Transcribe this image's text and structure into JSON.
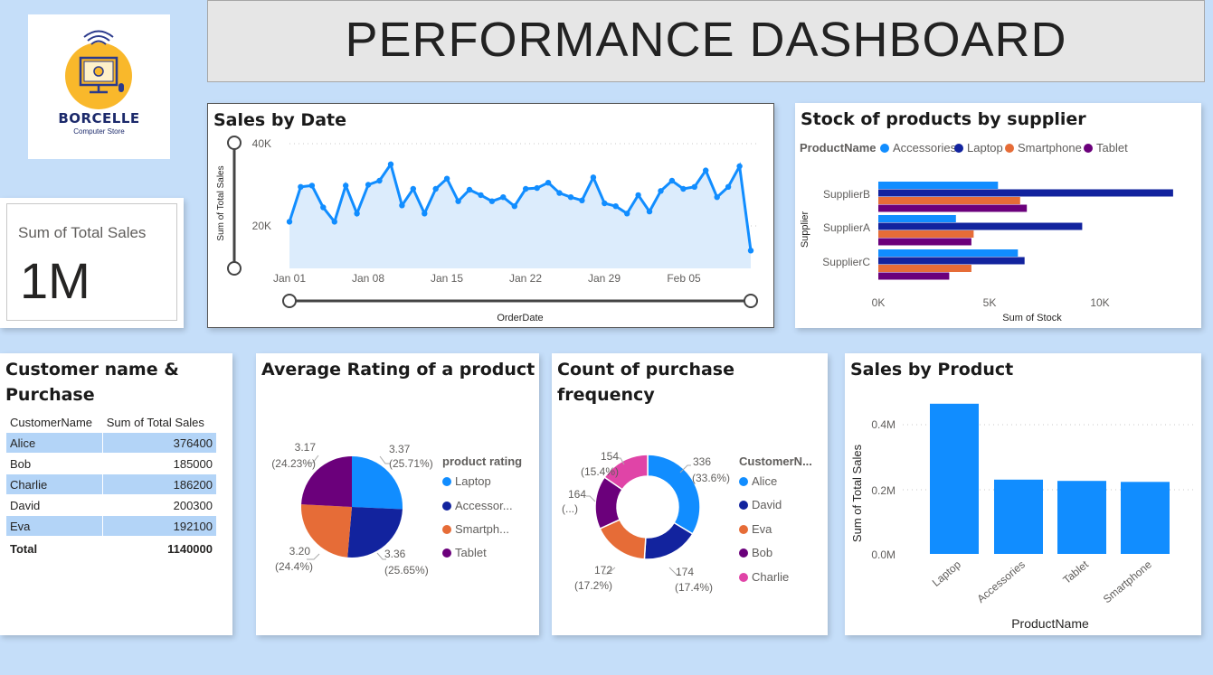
{
  "logo": {
    "brand": "BORCELLE",
    "tagline": "Computer Store"
  },
  "header": {
    "title": "PERFORMANCE DASHBOARD"
  },
  "kpi": {
    "label": "Sum of Total Sales",
    "value": "1M"
  },
  "colors": {
    "blue": "#118dff",
    "navy": "#12239e",
    "orange": "#e66c37",
    "purple": "#6b007b",
    "pink": "#e044a7",
    "area": "#dcecfc"
  },
  "sales_by_date": {
    "title": "Sales by Date",
    "ylabel": "Sum of Total Sales",
    "xlabel": "OrderDate",
    "yticks": [
      "40K",
      "20K"
    ],
    "xticks": [
      "Jan 01",
      "Jan 08",
      "Jan 15",
      "Jan 22",
      "Jan 29",
      "Feb 05"
    ]
  },
  "stock": {
    "title": "Stock of products by supplier",
    "legend_title": "ProductName",
    "legend": [
      "Accessories",
      "Laptop",
      "Smartphone",
      "Tablet"
    ],
    "ylabel": "Supplier",
    "xlabel": "Sum of Stock",
    "xticks": [
      "0K",
      "5K",
      "10K"
    ]
  },
  "customers": {
    "title": "Customer name & Purchase",
    "columns": [
      "CustomerName",
      "Sum of Total Sales"
    ],
    "rows": [
      [
        "Alice",
        "376400"
      ],
      [
        "Bob",
        "185000"
      ],
      [
        "Charlie",
        "186200"
      ],
      [
        "David",
        "200300"
      ],
      [
        "Eva",
        "192100"
      ]
    ],
    "total": [
      "Total",
      "1140000"
    ]
  },
  "rating": {
    "title": "Average Rating of a product",
    "legend_title": "product rating",
    "legend": [
      "Laptop",
      "Accessor...",
      "Smartph...",
      "Tablet"
    ],
    "labels": [
      {
        "value": "3.37",
        "pct": "(25.71%)"
      },
      {
        "value": "3.36",
        "pct": "(25.65%)"
      },
      {
        "value": "3.20",
        "pct": "(24.4%)"
      },
      {
        "value": "3.17",
        "pct": "(24.23%)"
      }
    ]
  },
  "frequency": {
    "title": "Count of purchase frequency",
    "legend_title": "CustomerN...",
    "legend": [
      "Alice",
      "David",
      "Eva",
      "Bob",
      "Charlie"
    ],
    "labels": [
      {
        "value": "336",
        "pct": "(33.6%)"
      },
      {
        "value": "174",
        "pct": "(17.4%)"
      },
      {
        "value": "172",
        "pct": "(17.2%)"
      },
      {
        "value": "164",
        "pct": "(...)"
      },
      {
        "value": "154",
        "pct": "(15.4%)"
      }
    ]
  },
  "sales_by_product": {
    "title": "Sales by Product",
    "ylabel": "Sum of Total Sales",
    "xlabel": "ProductName",
    "yticks": [
      "0.4M",
      "0.2M",
      "0.0M"
    ]
  },
  "chart_data": [
    {
      "type": "line",
      "x_start": "Jan 01",
      "x_tick_labels": [
        "Jan 01",
        "Jan 08",
        "Jan 15",
        "Jan 22",
        "Jan 29",
        "Feb 05"
      ],
      "values": [
        21000,
        29500,
        29800,
        24500,
        21000,
        29800,
        23000,
        30000,
        31000,
        35000,
        25000,
        29000,
        23000,
        29000,
        31500,
        26000,
        28800,
        27500,
        26000,
        27000,
        24800,
        29000,
        29200,
        30500,
        28000,
        27000,
        26200,
        31800,
        25500,
        24800,
        23000,
        27500,
        23500,
        28500,
        31000,
        29000,
        29500,
        33500,
        27000,
        29500,
        34500,
        14000
      ],
      "xlabel": "OrderDate",
      "ylabel": "Sum of Total Sales",
      "ylim": [
        0,
        48000
      ]
    },
    {
      "type": "bar",
      "orientation": "horizontal",
      "categories": [
        "SupplierB",
        "SupplierA",
        "SupplierC"
      ],
      "series": [
        {
          "name": "Accessories",
          "values": [
            5400,
            3500,
            6300
          ]
        },
        {
          "name": "Laptop",
          "values": [
            13300,
            9200,
            6600
          ]
        },
        {
          "name": "Smartphone",
          "values": [
            6400,
            4300,
            4200
          ]
        },
        {
          "name": "Tablet",
          "values": [
            6700,
            4200,
            3200
          ]
        }
      ],
      "xlabel": "Sum of Stock",
      "ylabel": "Supplier",
      "xlim": [
        0,
        14000
      ]
    },
    {
      "type": "pie",
      "categories": [
        "Laptop",
        "Accessories",
        "Smartphone",
        "Tablet"
      ],
      "values": [
        3.37,
        3.36,
        3.2,
        3.17
      ],
      "percent": [
        25.71,
        25.65,
        24.4,
        24.23
      ]
    },
    {
      "type": "pie",
      "donut": true,
      "categories": [
        "Alice",
        "David",
        "Eva",
        "Bob",
        "Charlie"
      ],
      "values": [
        336,
        174,
        172,
        164,
        154
      ],
      "percent": [
        33.6,
        17.4,
        17.2,
        16.4,
        15.4
      ]
    },
    {
      "type": "bar",
      "categories": [
        "Laptop",
        "Accessories",
        "Tablet",
        "Smartphone"
      ],
      "values": [
        465000,
        230000,
        226000,
        223000
      ],
      "xlabel": "ProductName",
      "ylabel": "Sum of Total Sales",
      "ylim": [
        0,
        500000
      ]
    }
  ]
}
